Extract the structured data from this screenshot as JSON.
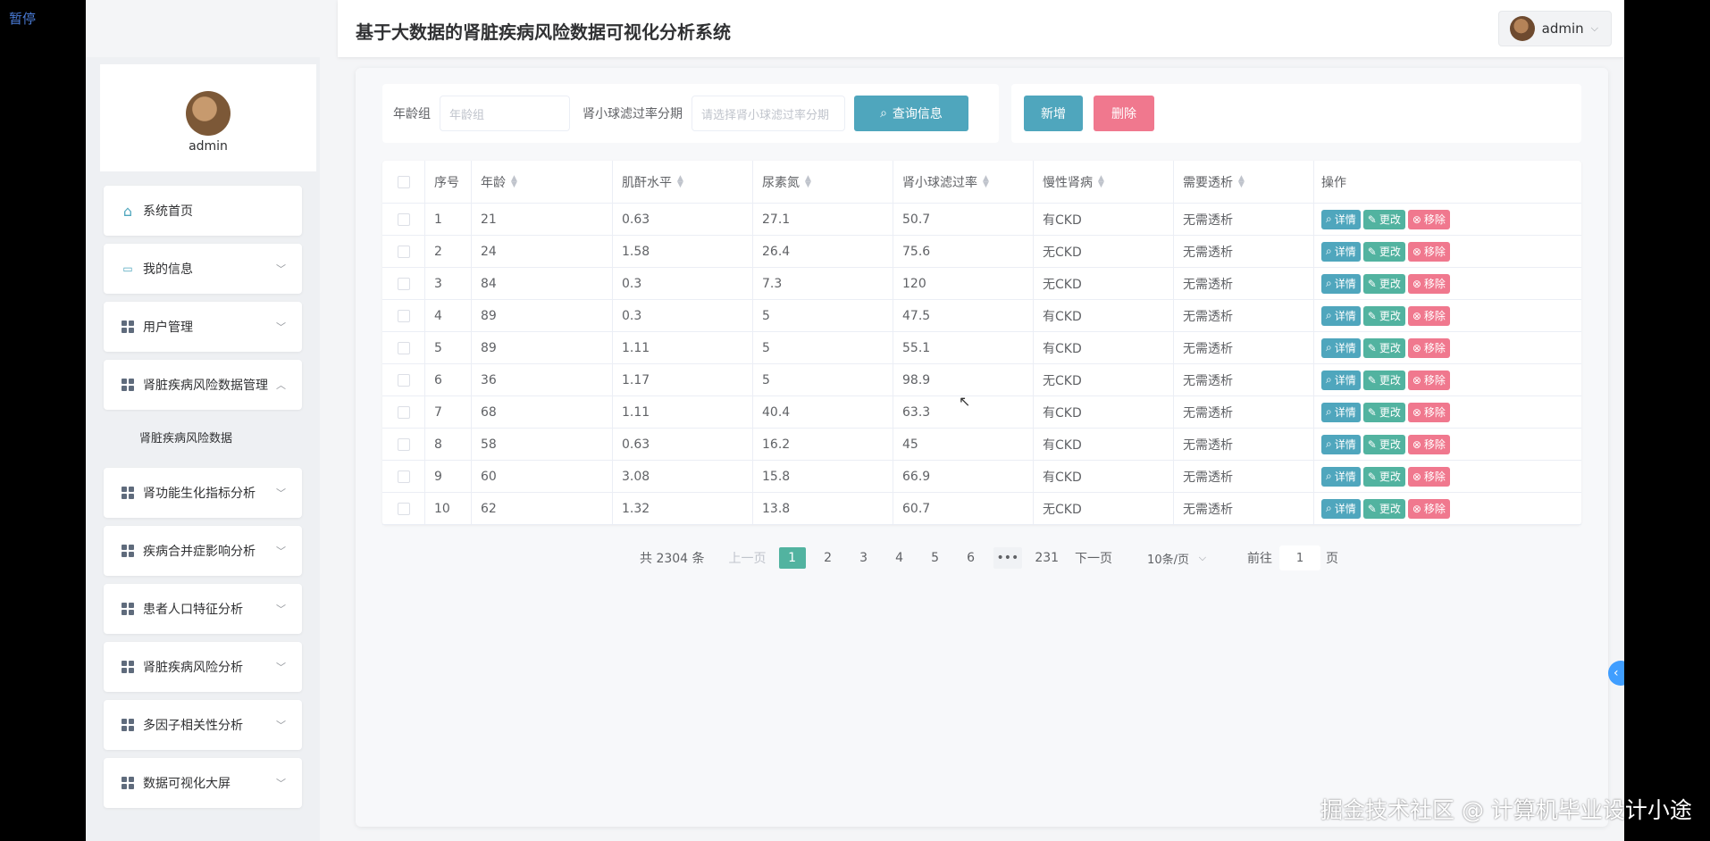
{
  "overlay": {
    "pause_label": "暂停",
    "watermark": "掘金技术社区 @ 计算机毕业设计小途"
  },
  "header": {
    "title": "基于大数据的肾脏疾病风险数据可视化分析系统",
    "user": "admin"
  },
  "sidebar": {
    "profile_name": "admin",
    "items": [
      {
        "label": "系统首页",
        "icon": "home-icon",
        "expandable": false
      },
      {
        "label": "我的信息",
        "icon": "card-icon",
        "expandable": true
      },
      {
        "label": "用户管理",
        "icon": "grid-icon",
        "expandable": true
      },
      {
        "label": "肾脏疾病风险数据管理",
        "icon": "grid-icon",
        "expandable": true,
        "expanded": true
      },
      {
        "label": "肾功能生化指标分析",
        "icon": "grid-icon",
        "expandable": true
      },
      {
        "label": "疾病合并症影响分析",
        "icon": "grid-icon",
        "expandable": true
      },
      {
        "label": "患者人口特征分析",
        "icon": "grid-icon",
        "expandable": true
      },
      {
        "label": "肾脏疾病风险分析",
        "icon": "grid-icon",
        "expandable": true
      },
      {
        "label": "多因子相关性分析",
        "icon": "grid-icon",
        "expandable": true
      },
      {
        "label": "数据可视化大屏",
        "icon": "grid-icon",
        "expandable": true
      }
    ],
    "submenu": {
      "label": "肾脏疾病风险数据"
    }
  },
  "filters": {
    "age_label": "年龄组",
    "age_placeholder": "年龄组",
    "gfr_label": "肾小球滤过率分期",
    "gfr_placeholder": "请选择肾小球滤过率分期",
    "query_button": "查询信息"
  },
  "actions": {
    "add": "新增",
    "delete": "删除"
  },
  "table": {
    "headers": [
      "序号",
      "年龄",
      "肌酐水平",
      "尿素氮",
      "肾小球滤过率",
      "慢性肾病",
      "需要透析",
      "操作"
    ],
    "op_labels": {
      "detail": "详情",
      "edit": "更改",
      "remove": "移除"
    },
    "rows": [
      [
        "1",
        "21",
        "0.63",
        "27.1",
        "50.7",
        "有CKD",
        "无需透析"
      ],
      [
        "2",
        "24",
        "1.58",
        "26.4",
        "75.6",
        "无CKD",
        "无需透析"
      ],
      [
        "3",
        "84",
        "0.3",
        "7.3",
        "120",
        "无CKD",
        "无需透析"
      ],
      [
        "4",
        "89",
        "0.3",
        "5",
        "47.5",
        "有CKD",
        "无需透析"
      ],
      [
        "5",
        "89",
        "1.11",
        "5",
        "55.1",
        "有CKD",
        "无需透析"
      ],
      [
        "6",
        "36",
        "1.17",
        "5",
        "98.9",
        "无CKD",
        "无需透析"
      ],
      [
        "7",
        "68",
        "1.11",
        "40.4",
        "63.3",
        "有CKD",
        "无需透析"
      ],
      [
        "8",
        "58",
        "0.63",
        "16.2",
        "45",
        "有CKD",
        "无需透析"
      ],
      [
        "9",
        "60",
        "3.08",
        "15.8",
        "66.9",
        "有CKD",
        "无需透析"
      ],
      [
        "10",
        "62",
        "1.32",
        "13.8",
        "60.7",
        "无CKD",
        "无需透析"
      ]
    ]
  },
  "pagination": {
    "total": "共 2304 条",
    "prev": "上一页",
    "pages": [
      "1",
      "2",
      "3",
      "4",
      "5",
      "6"
    ],
    "current": "1",
    "more": "•••",
    "last": "231",
    "next": "下一页",
    "page_size": "10条/页",
    "goto_label": "前往",
    "goto_value": "1",
    "goto_suffix": "页"
  }
}
